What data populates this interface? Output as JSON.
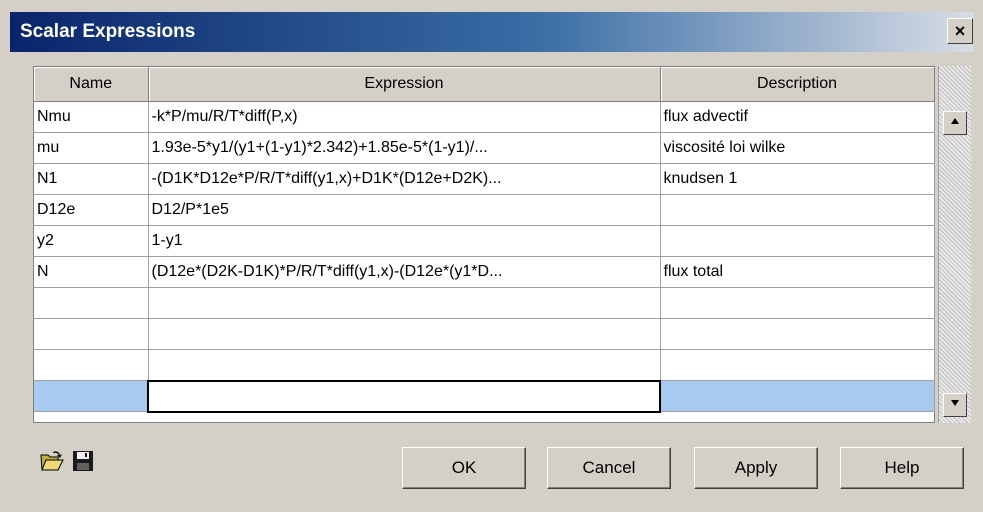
{
  "window": {
    "title": "Scalar Expressions",
    "close_label": "×"
  },
  "table": {
    "headers": {
      "name": "Name",
      "expression": "Expression",
      "description": "Description"
    },
    "rows": [
      {
        "name": "Nmu",
        "expression": "-k*P/mu/R/T*diff(P,x)",
        "description": "flux advectif"
      },
      {
        "name": "mu",
        "expression": "1.93e-5*y1/(y1+(1-y1)*2.342)+1.85e-5*(1-y1)/...",
        "description": "viscosité loi wilke"
      },
      {
        "name": "N1",
        "expression": "-(D1K*D12e*P/R/T*diff(y1,x)+D1K*(D12e+D2K)...",
        "description": "knudsen 1"
      },
      {
        "name": "D12e",
        "expression": "D12/P*1e5",
        "description": ""
      },
      {
        "name": "y2",
        "expression": "1-y1",
        "description": ""
      },
      {
        "name": "N",
        "expression": "(D12e*(D2K-D1K)*P/R/T*diff(y1,x)-(D12e*(y1*D...",
        "description": "flux total"
      },
      {
        "name": "",
        "expression": "",
        "description": ""
      },
      {
        "name": "",
        "expression": "",
        "description": ""
      },
      {
        "name": "",
        "expression": "",
        "description": ""
      },
      {
        "name": "",
        "expression": "",
        "description": ""
      }
    ]
  },
  "icons": {
    "open": "open-folder-icon",
    "save": "save-disk-icon"
  },
  "buttons": {
    "ok": "OK",
    "cancel": "Cancel",
    "apply": "Apply",
    "help": "Help"
  },
  "colors": {
    "title_gradient_start": "#0a246a",
    "selection": "#a6caf0",
    "face": "#d4d0c8"
  }
}
